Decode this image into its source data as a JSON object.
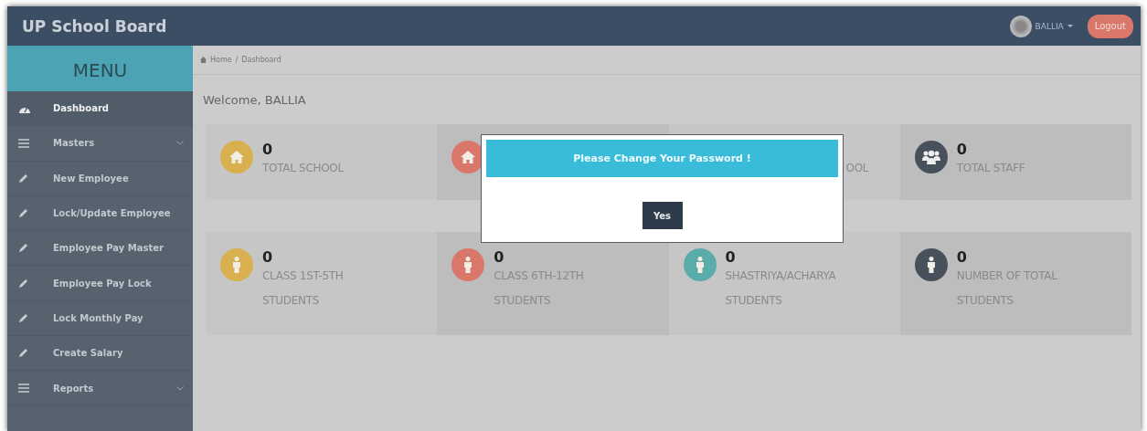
{
  "header": {
    "title": "UP School Board",
    "user": "BALLIA",
    "logout": "Logout"
  },
  "sidebar": {
    "heading": "MENU",
    "items": [
      {
        "label": "Dashboard",
        "kind": "dashboard",
        "selected": true,
        "submenu": false
      },
      {
        "label": "Masters",
        "kind": "list",
        "selected": false,
        "submenu": true
      },
      {
        "label": "New Employee",
        "kind": "edit",
        "selected": false,
        "submenu": false
      },
      {
        "label": "Lock/Update Employee",
        "kind": "edit",
        "selected": false,
        "submenu": false
      },
      {
        "label": "Employee Pay Master",
        "kind": "edit",
        "selected": false,
        "submenu": false
      },
      {
        "label": "Employee Pay Lock",
        "kind": "edit",
        "selected": false,
        "submenu": false
      },
      {
        "label": "Lock Monthly Pay",
        "kind": "edit",
        "selected": false,
        "submenu": false
      },
      {
        "label": "Create Salary",
        "kind": "edit",
        "selected": false,
        "submenu": false
      },
      {
        "label": "Reports",
        "kind": "list",
        "selected": false,
        "submenu": true
      }
    ]
  },
  "breadcrumb": [
    {
      "label": "Home",
      "kind": "home"
    },
    {
      "label": "/",
      "kind": "separator"
    },
    {
      "label": "Dashboard",
      "kind": "link"
    }
  ],
  "welcome": "Welcome, BALLIA",
  "card_rows": [
    [
      {
        "kind": "home",
        "color": "#d9b04f",
        "value": "0",
        "label": "TOTAL SCHOOL"
      },
      {
        "kind": "home",
        "color": "#d9776b"
      },
      {
        "label": "OOL",
        "kind": "covered"
      },
      {
        "kind": "group",
        "color": "#48505c",
        "value": "0",
        "label": "TOTAL STAFF"
      }
    ],
    [
      {
        "kind": "person",
        "color": "#d9b04f",
        "value": "0",
        "label": "CLASS 1ST-5TH\nSTUDENTS"
      },
      {
        "kind": "person",
        "color": "#d9776b",
        "value": "0",
        "label": "CLASS 6TH-12TH\nSTUDENTS"
      },
      {
        "kind": "person",
        "color": "#5aacab",
        "value": "0",
        "label": "SHASTRIYA/ACHARYA\nSTUDENTS"
      },
      {
        "kind": "person",
        "color": "#48505c",
        "value": "0",
        "label": "NUMBER OF TOTAL\nSTUDENTS"
      }
    ]
  ],
  "dialog": {
    "title": "Please Change Your Password !",
    "button": "Yes"
  }
}
